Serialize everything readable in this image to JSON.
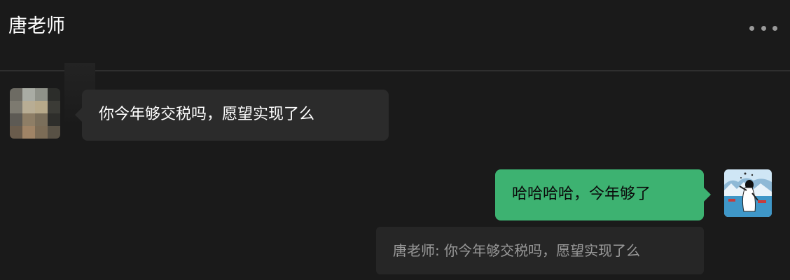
{
  "header": {
    "title": "唐老师",
    "more_icon": "more-horizontal-icon"
  },
  "messages": {
    "incoming": {
      "text": "你今年够交税吗，愿望实现了么",
      "avatar": "blurred-avatar"
    },
    "outgoing": {
      "text": "哈哈哈哈，今年够了",
      "avatar": "illustrated-avatar"
    },
    "quote": {
      "text": "唐老师: 你今年够交税吗，愿望实现了么"
    }
  },
  "colors": {
    "background": "#1a1a1a",
    "incoming_bubble": "#2b2b2b",
    "outgoing_bubble": "#3db271",
    "quote_bubble": "#262626"
  }
}
